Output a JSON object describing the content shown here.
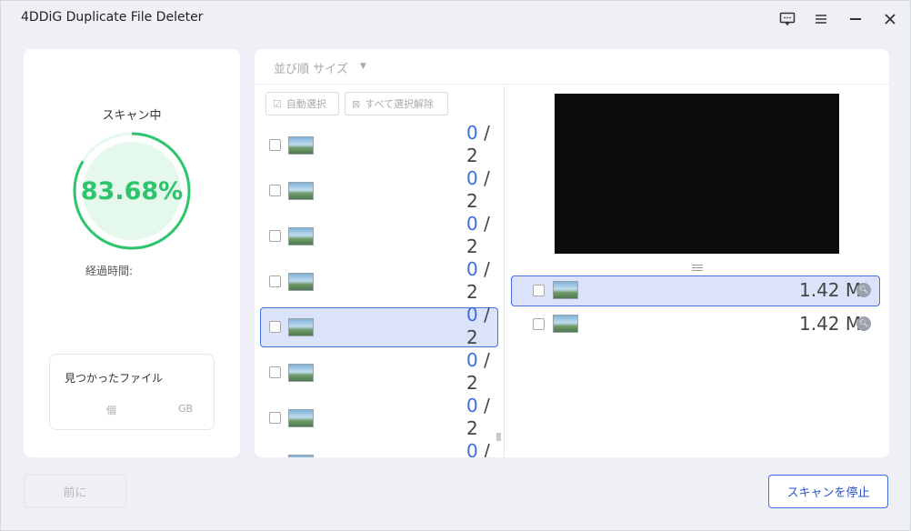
{
  "window": {
    "title": "4DDiG Duplicate File Deleter"
  },
  "scan": {
    "status_label": "スキャン中",
    "progress_text": "83.68%",
    "progress_fraction": 0.8368,
    "elapsed_label": "経過時間:",
    "found_title": "見つかったファイル",
    "count_unit": "個",
    "size_unit": "GB"
  },
  "sort": {
    "label": "並び順 サイズ"
  },
  "toolbar": {
    "auto_select_label": "自動選択",
    "deselect_all_label": "すべて選択解除"
  },
  "groups": [
    {
      "selected_count": "0",
      "separator": "/",
      "total": "2",
      "highlighted": false
    },
    {
      "selected_count": "0",
      "separator": "/",
      "total": "2",
      "highlighted": false
    },
    {
      "selected_count": "0",
      "separator": "/",
      "total": "2",
      "highlighted": false
    },
    {
      "selected_count": "0",
      "separator": "/",
      "total": "2",
      "highlighted": false
    },
    {
      "selected_count": "0",
      "separator": "/",
      "total": "2",
      "highlighted": true
    },
    {
      "selected_count": "0",
      "separator": "/",
      "total": "2",
      "highlighted": false
    },
    {
      "selected_count": "0",
      "separator": "/",
      "total": "2",
      "highlighted": false
    },
    {
      "selected_count": "0",
      "separator": "/",
      "total": "",
      "highlighted": false
    }
  ],
  "files": [
    {
      "size": "1.42 M",
      "highlighted": true
    },
    {
      "size": "1.42 M",
      "highlighted": false
    }
  ],
  "footer": {
    "back_label": "前に",
    "stop_label": "スキャンを停止"
  },
  "icons": {
    "feedback": "feedback-icon",
    "menu": "menu-icon",
    "minimize": "minimize-icon",
    "close": "close-icon",
    "thumbnail": "image-thumbnail-icon",
    "magnify": "magnify-icon"
  },
  "colors": {
    "accent": "#3d6ee0",
    "progress": "#2cc56d",
    "progress_bg": "#e5f8ec",
    "selection_bg": "#dbe3fb"
  }
}
